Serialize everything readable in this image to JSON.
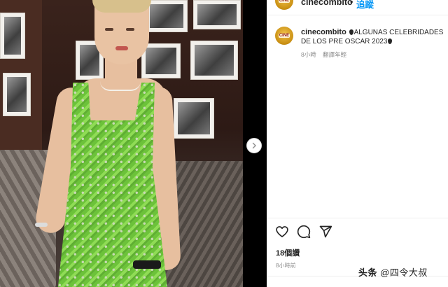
{
  "post": {
    "image_alt": "Woman in green sequined dress posing in front of framed photos",
    "next_icon": "chevron-right-icon"
  },
  "header": {
    "username": "cinecombito",
    "separator": "•",
    "follow_label": "追蹤",
    "avatar_text": "CINE"
  },
  "caption": {
    "username": "cinecombito",
    "text_part1": "ALGUNAS CELEBRIDADES DE LOS PRE OSCAR 2023",
    "time": "8小時",
    "translate_label": "翻譯年輕"
  },
  "actions": {
    "like_icon": "heart-icon",
    "comment_icon": "comment-icon",
    "share_icon": "send-icon",
    "likes": "18個讚",
    "posted": "8小時前"
  },
  "watermark": {
    "platform": "头条",
    "handle": "@四令大叔"
  },
  "colors": {
    "link_blue": "#0095f6",
    "dress_green": "#6cc23a",
    "text": "#262626",
    "muted": "#8e8e8e"
  }
}
